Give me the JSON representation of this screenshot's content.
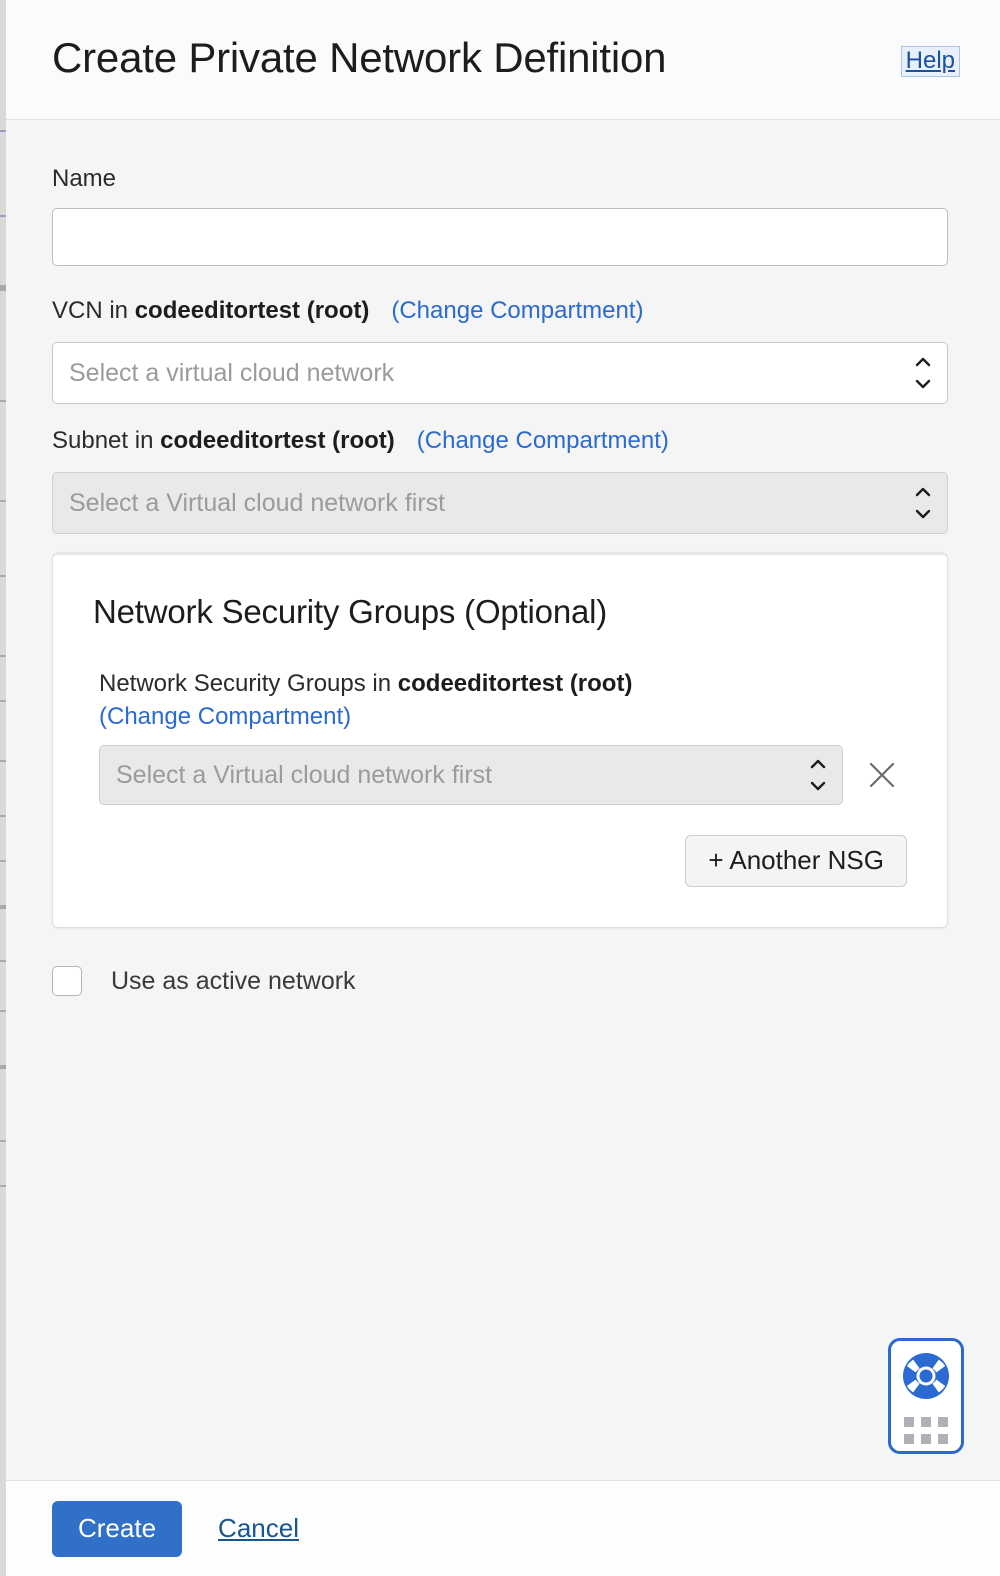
{
  "header": {
    "title": "Create Private Network Definition",
    "help_label": "Help"
  },
  "form": {
    "name_field": {
      "label": "Name",
      "value": "",
      "placeholder": ""
    },
    "vcn_field": {
      "label_prefix": "VCN in ",
      "compartment": "codeeditortest (root)",
      "change_compartment_label": "(Change Compartment)",
      "placeholder": "Select a virtual cloud network",
      "value": "",
      "disabled": false
    },
    "subnet_field": {
      "label_prefix": "Subnet in ",
      "compartment": "codeeditortest (root)",
      "change_compartment_label": "(Change Compartment)",
      "placeholder": "Select a Virtual cloud network first",
      "value": "",
      "disabled": true
    },
    "nsg_panel": {
      "title": "Network Security Groups (Optional)",
      "label_prefix": "Network Security Groups in ",
      "compartment": "codeeditortest (root)",
      "change_compartment_label": "(Change Compartment)",
      "select_placeholder": "Select a Virtual cloud network first",
      "select_value": "",
      "remove_icon": "close-icon",
      "add_button_label": "+ Another NSG"
    },
    "active_network_checkbox": {
      "label": "Use as active network",
      "checked": false
    }
  },
  "support_widget": {
    "icon": "lifebuoy-icon",
    "grid_icon": "app-grid-icon"
  },
  "footer": {
    "create_label": "Create",
    "cancel_label": "Cancel"
  },
  "colors": {
    "accent_blue": "#3070c8",
    "link_blue": "#2a6ad1",
    "page_bg": "#f5f5f5",
    "panel_bg": "#ffffff",
    "disabled_bg": "#e9e9e9"
  }
}
